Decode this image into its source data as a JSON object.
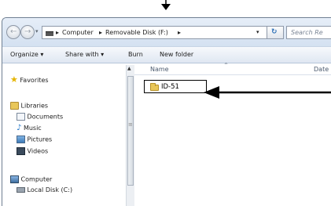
{
  "address_bar": {
    "crumbs": [
      "Computer",
      "Removable Disk (F:)"
    ]
  },
  "search": {
    "placeholder": "Search Re"
  },
  "toolbar": {
    "organize": "Organize ▾",
    "share_with": "Share with ▾",
    "burn": "Burn",
    "new_folder": "New folder"
  },
  "nav_pane": {
    "favorites": "Favorites",
    "libraries": "Libraries",
    "documents": "Documents",
    "music": "Music",
    "pictures": "Pictures",
    "videos": "Videos",
    "computer": "Computer",
    "local_disk": "Local Disk (C:)"
  },
  "content": {
    "col_name": "Name",
    "col_date": "Date r",
    "folder_name": "ID-51"
  },
  "colors": {
    "annotation": "#000000",
    "folder": "#e9c75a"
  }
}
